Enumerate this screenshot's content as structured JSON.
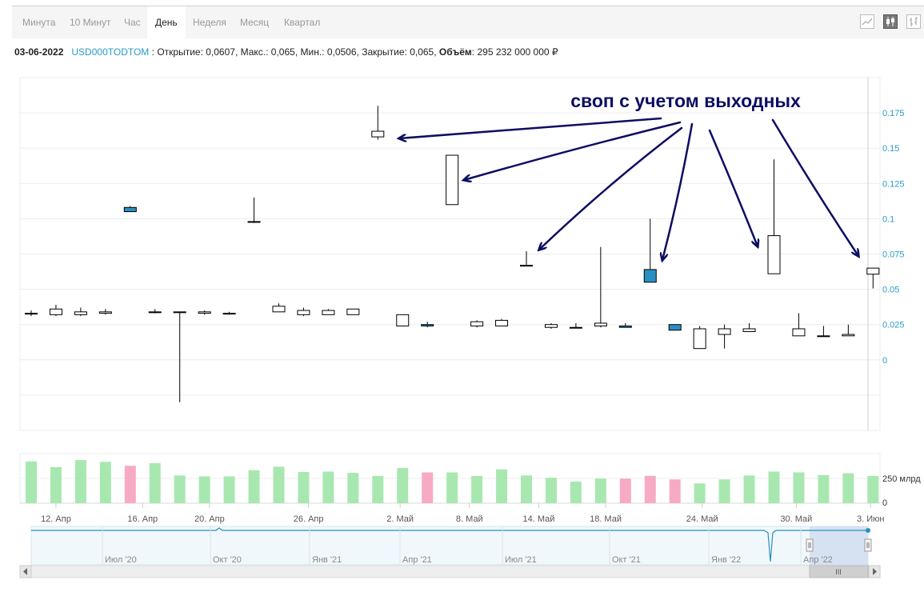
{
  "toolbar": {
    "tabs": [
      "Минута",
      "10 Минут",
      "Час",
      "День",
      "Неделя",
      "Месяц",
      "Квартал"
    ],
    "active_tab": "День",
    "chart_types": [
      "line-chart-icon",
      "candlestick-chart-icon",
      "ohlc-chart-icon"
    ]
  },
  "info": {
    "date": "03-06-2022",
    "ticker": "USD000TODTOM",
    "values": " : Открытие: 0,0607, Макс.: 0,065, Мин.: 0,0506, Закрытие: 0,065, ",
    "volume_label": "Объём",
    "volume_value": ": 295 232 000 000 ₽"
  },
  "annotation": "своп с учетом выходных",
  "colors": {
    "up": "#ffffff",
    "down": "#2a8fc0",
    "vol_up": "#a8e8b0",
    "vol_down": "#f7aac4",
    "axis_label": "#2a9bc7",
    "annotation": "#0d0d63"
  },
  "chart_data": {
    "type": "candlestick",
    "ylim": [
      -0.05,
      0.2
    ],
    "y_ticks": [
      "0.175",
      "0.15",
      "0.125",
      "0.1",
      "0.075",
      "0.05",
      "0.025",
      "0"
    ],
    "y_tick_values": [
      0.175,
      0.15,
      0.125,
      0.1,
      0.075,
      0.05,
      0.025,
      0
    ],
    "x_ticks": [
      {
        "label": "12. Апр",
        "index": 1
      },
      {
        "label": "16. Апр",
        "index": 4.5
      },
      {
        "label": "20. Апр",
        "index": 7.2
      },
      {
        "label": "26. Апр",
        "index": 11.2
      },
      {
        "label": "2. Май",
        "index": 14.9
      },
      {
        "label": "8. Май",
        "index": 17.7
      },
      {
        "label": "14. Май",
        "index": 20.5
      },
      {
        "label": "18. Май",
        "index": 23.2
      },
      {
        "label": "24. Май",
        "index": 27.1
      },
      {
        "label": "30. Май",
        "index": 30.9
      },
      {
        "label": "3. Июн",
        "index": 33.9
      }
    ],
    "candles": [
      {
        "o": 0.033,
        "h": 0.035,
        "l": 0.031,
        "c": 0.033,
        "v": 95
      },
      {
        "o": 0.032,
        "h": 0.039,
        "l": 0.031,
        "c": 0.036,
        "v": 82
      },
      {
        "o": 0.032,
        "h": 0.037,
        "l": 0.031,
        "c": 0.034,
        "v": 98
      },
      {
        "o": 0.033,
        "h": 0.036,
        "l": 0.032,
        "c": 0.034,
        "v": 94
      },
      {
        "o": 0.108,
        "h": 0.109,
        "l": 0.105,
        "c": 0.105,
        "v": 85
      },
      {
        "o": 0.034,
        "h": 0.036,
        "l": 0.033,
        "c": 0.034,
        "v": 91
      },
      {
        "o": 0.034,
        "h": 0.034,
        "l": -0.03,
        "c": 0.034,
        "v": 63
      },
      {
        "o": 0.033,
        "h": 0.035,
        "l": 0.032,
        "c": 0.034,
        "v": 61
      },
      {
        "o": 0.033,
        "h": 0.034,
        "l": 0.032,
        "c": 0.033,
        "v": 61
      },
      {
        "o": 0.098,
        "h": 0.115,
        "l": 0.097,
        "c": 0.098,
        "v": 75
      },
      {
        "o": 0.034,
        "h": 0.04,
        "l": 0.034,
        "c": 0.038,
        "v": 83
      },
      {
        "o": 0.032,
        "h": 0.037,
        "l": 0.031,
        "c": 0.035,
        "v": 71
      },
      {
        "o": 0.032,
        "h": 0.036,
        "l": 0.032,
        "c": 0.035,
        "v": 72
      },
      {
        "o": 0.032,
        "h": 0.036,
        "l": 0.032,
        "c": 0.036,
        "v": 69
      },
      {
        "o": 0.158,
        "h": 0.18,
        "l": 0.156,
        "c": 0.162,
        "v": 62
      },
      {
        "o": 0.024,
        "h": 0.032,
        "l": 0.024,
        "c": 0.032,
        "v": 80
      },
      {
        "o": 0.025,
        "h": 0.027,
        "l": 0.023,
        "c": 0.024,
        "v": 70
      },
      {
        "o": 0.11,
        "h": 0.145,
        "l": 0.11,
        "c": 0.145,
        "v": 70
      },
      {
        "o": 0.024,
        "h": 0.028,
        "l": 0.023,
        "c": 0.027,
        "v": 62
      },
      {
        "o": 0.024,
        "h": 0.029,
        "l": 0.024,
        "c": 0.028,
        "v": 77
      },
      {
        "o": 0.067,
        "h": 0.077,
        "l": 0.067,
        "c": 0.067,
        "v": 63
      },
      {
        "o": 0.023,
        "h": 0.026,
        "l": 0.022,
        "c": 0.025,
        "v": 58
      },
      {
        "o": 0.023,
        "h": 0.026,
        "l": 0.023,
        "c": 0.023,
        "v": 49
      },
      {
        "o": 0.024,
        "h": 0.08,
        "l": 0.023,
        "c": 0.026,
        "v": 56
      },
      {
        "o": 0.024,
        "h": 0.026,
        "l": 0.023,
        "c": 0.023,
        "v": 56
      },
      {
        "o": 0.064,
        "h": 0.1,
        "l": 0.055,
        "c": 0.055,
        "v": 62
      },
      {
        "o": 0.025,
        "h": 0.025,
        "l": 0.021,
        "c": 0.021,
        "v": 54
      },
      {
        "o": 0.008,
        "h": 0.024,
        "l": 0.008,
        "c": 0.022,
        "v": 45
      },
      {
        "o": 0.018,
        "h": 0.025,
        "l": 0.008,
        "c": 0.022,
        "v": 54
      },
      {
        "o": 0.02,
        "h": 0.026,
        "l": 0.02,
        "c": 0.022,
        "v": 63
      },
      {
        "o": 0.061,
        "h": 0.142,
        "l": 0.061,
        "c": 0.088,
        "v": 72
      },
      {
        "o": 0.017,
        "h": 0.033,
        "l": 0.017,
        "c": 0.022,
        "v": 70
      },
      {
        "o": 0.017,
        "h": 0.024,
        "l": 0.017,
        "c": 0.017,
        "v": 64
      },
      {
        "o": 0.017,
        "h": 0.025,
        "l": 0.017,
        "c": 0.018,
        "v": 68
      },
      {
        "o": 0.0607,
        "h": 0.065,
        "l": 0.0506,
        "c": 0.065,
        "v": 62
      }
    ],
    "volume_axis_labels": [
      "250 млрд",
      "0"
    ],
    "navigator_labels": [
      "Июл '20",
      "Окт '20",
      "Янв '21",
      "Апр '21",
      "Июл '21",
      "Окт '21",
      "Янв '22",
      "Апр '22"
    ],
    "navigator_handle_label": "III"
  }
}
